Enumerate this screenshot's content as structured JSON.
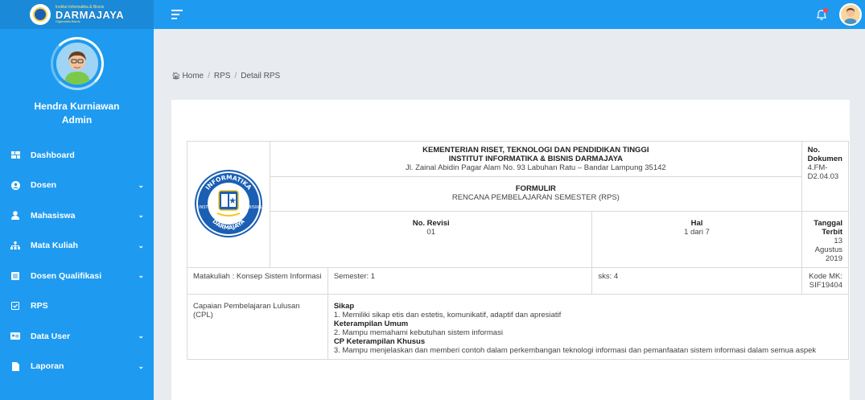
{
  "brand": {
    "small_top": "Institut Informatika & Bisnis",
    "name": "DARMAJAYA",
    "small_bottom": "Gigimatika Bisnis"
  },
  "profile": {
    "name": "Hendra Kurniawan",
    "role": "Admin"
  },
  "menu": [
    {
      "label": "Dashboard",
      "icon": "dashboard-icon",
      "has_submenu": false
    },
    {
      "label": "Dosen",
      "icon": "user-circle-icon",
      "has_submenu": true
    },
    {
      "label": "Mahasiswa",
      "icon": "user-icon",
      "has_submenu": true
    },
    {
      "label": "Mata Kuliah",
      "icon": "sitemap-icon",
      "has_submenu": true
    },
    {
      "label": "Dosen Qualifikasi",
      "icon": "list-icon",
      "has_submenu": true
    },
    {
      "label": "RPS",
      "icon": "checkbox-icon",
      "has_submenu": false
    },
    {
      "label": "Data User",
      "icon": "id-card-icon",
      "has_submenu": true
    },
    {
      "label": "Laporan",
      "icon": "file-icon",
      "has_submenu": true
    }
  ],
  "breadcrumb": {
    "home": "Home",
    "rps": "RPS",
    "current": "Detail RPS"
  },
  "document": {
    "header_line1": "KEMENTERIAN RISET, TEKNOLOGI DAN PENDIDIKAN TINGGI",
    "header_line2": "INSTITUT INFORMATIKA & BISNIS DARMAJAYA",
    "header_address": "Jl. Zainal Abidin Pagar Alam No. 93 Labuhan Ratu – Bandar Lampung 35142",
    "no_dokumen_label1": "No.",
    "no_dokumen_label2": "Dokumen",
    "no_dokumen_value1": "4.FM-",
    "no_dokumen_value2": "D2.04.03",
    "formulir_title": "FORMULIR",
    "formulir_subtitle": "RENCANA PEMBELAJARAN SEMESTER (RPS)",
    "no_revisi_label": "No. Revisi",
    "no_revisi_value": "01",
    "hal_label": "Hal",
    "hal_value": "1 dari 7",
    "tanggal_label1": "Tanggal",
    "tanggal_label2": "Terbit",
    "tanggal_value1": "13 Agustus",
    "tanggal_value2": "2019",
    "matakuliah": "Matakuliah : Konsep Sistem Informasi",
    "semester": "Semester: 1",
    "sks": "sks: 4",
    "kode_mk_label": "Kode MK:",
    "kode_mk_value": "SIF19404",
    "cpl_label": "Capaian Pembelajaran Lulusan (CPL)",
    "cpl_sikap_title": "Sikap",
    "cpl_sikap_1": "1. Memiliki sikap etis dan estetis, komunikatif, adaptif dan apresiatif",
    "cpl_ku_title": "Keterampilan Umum",
    "cpl_ku_2": "2. Mampu memahami kebutuhan sistem informasi",
    "cpl_kk_title": "CP Keterampilan Khusus",
    "cpl_kk_3": "3. Mampu menjelaskan dan memberi contoh dalam perkembangan teknologi informasi dan pemanfaatan sistem informasi dalam semua aspek"
  },
  "seal_text": {
    "top": "INFORMATIKA",
    "left": "INSTITUT",
    "right": "BISNIS",
    "bottom": "DARMAJAYA"
  },
  "colors": {
    "primary": "#1e9bf0",
    "primary_dark": "#1a8ad8",
    "notification": "#ff4444"
  }
}
